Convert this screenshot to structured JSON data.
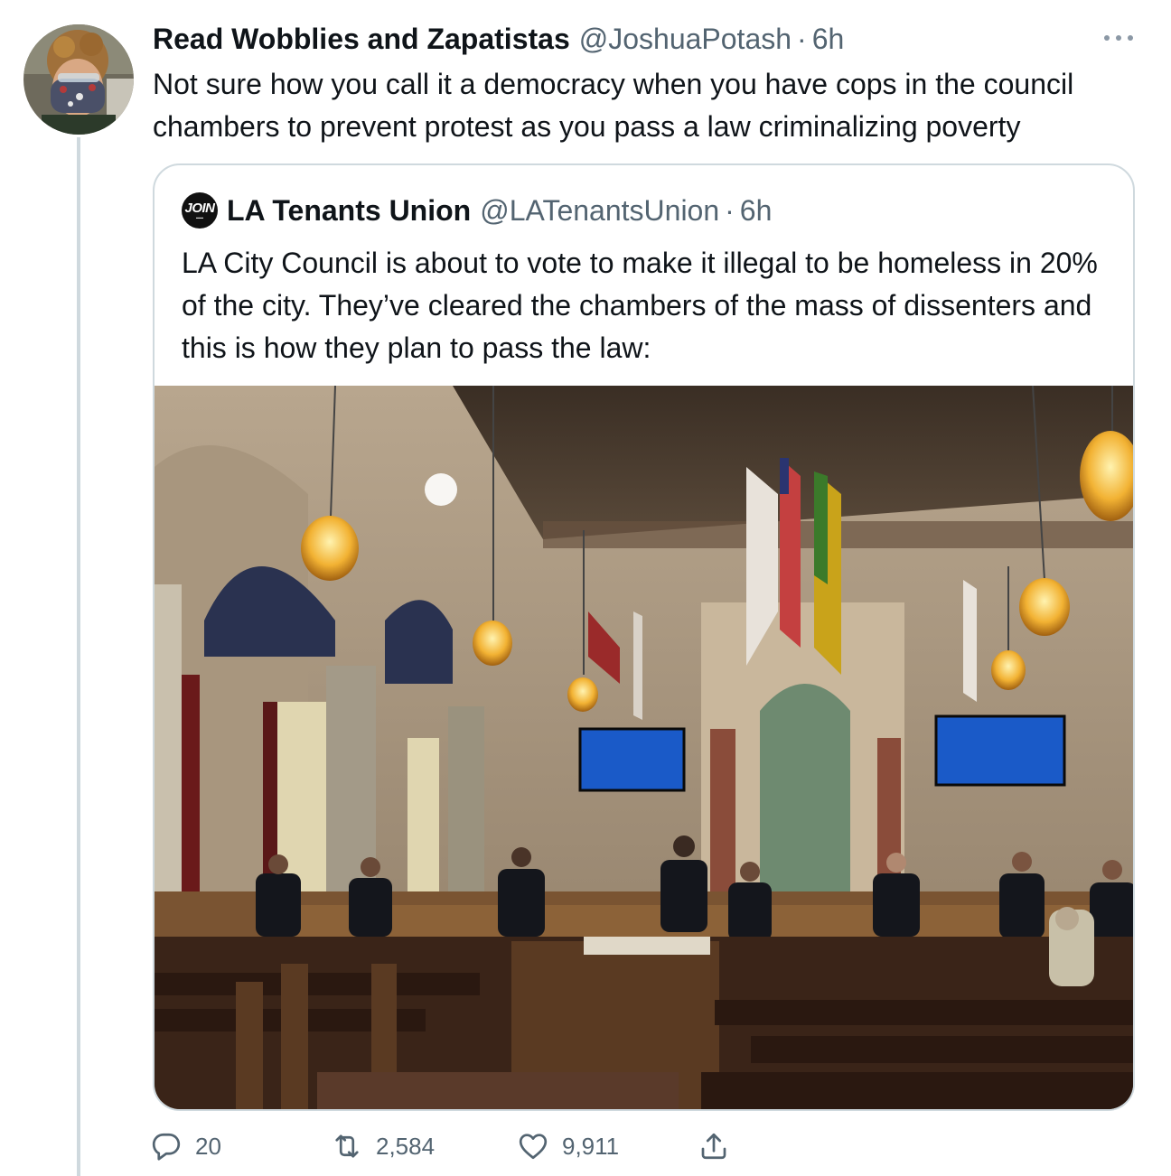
{
  "tweet": {
    "display_name": "Read Wobblies and Zapatistas",
    "handle": "@JoshuaPotash",
    "separator": "·",
    "time": "6h",
    "text": "Not sure how you call it a democracy when you have cops in the council chambers to prevent protest as you pass a law criminalizing poverty"
  },
  "quoted_tweet": {
    "avatar_logo_text": "JOIN",
    "display_name": "LA Tenants Union",
    "handle": "@LATenantsUnion",
    "separator": "·",
    "time": "6h",
    "text": "LA City Council is about to vote to make it illegal to be homeless in 20% of the city. They’ve cleared the chambers of the mass of dissenters and this is how they plan to pass the law:"
  },
  "actions": {
    "reply_count": "20",
    "retweet_count": "2,584",
    "like_count": "9,911"
  },
  "icons": {
    "more": "more-horizontal-icon",
    "reply": "reply-icon",
    "retweet": "retweet-icon",
    "like": "heart-icon",
    "share": "share-icon"
  },
  "colors": {
    "text_primary": "#0f1419",
    "text_secondary": "#536471",
    "border": "#cfd9de"
  }
}
